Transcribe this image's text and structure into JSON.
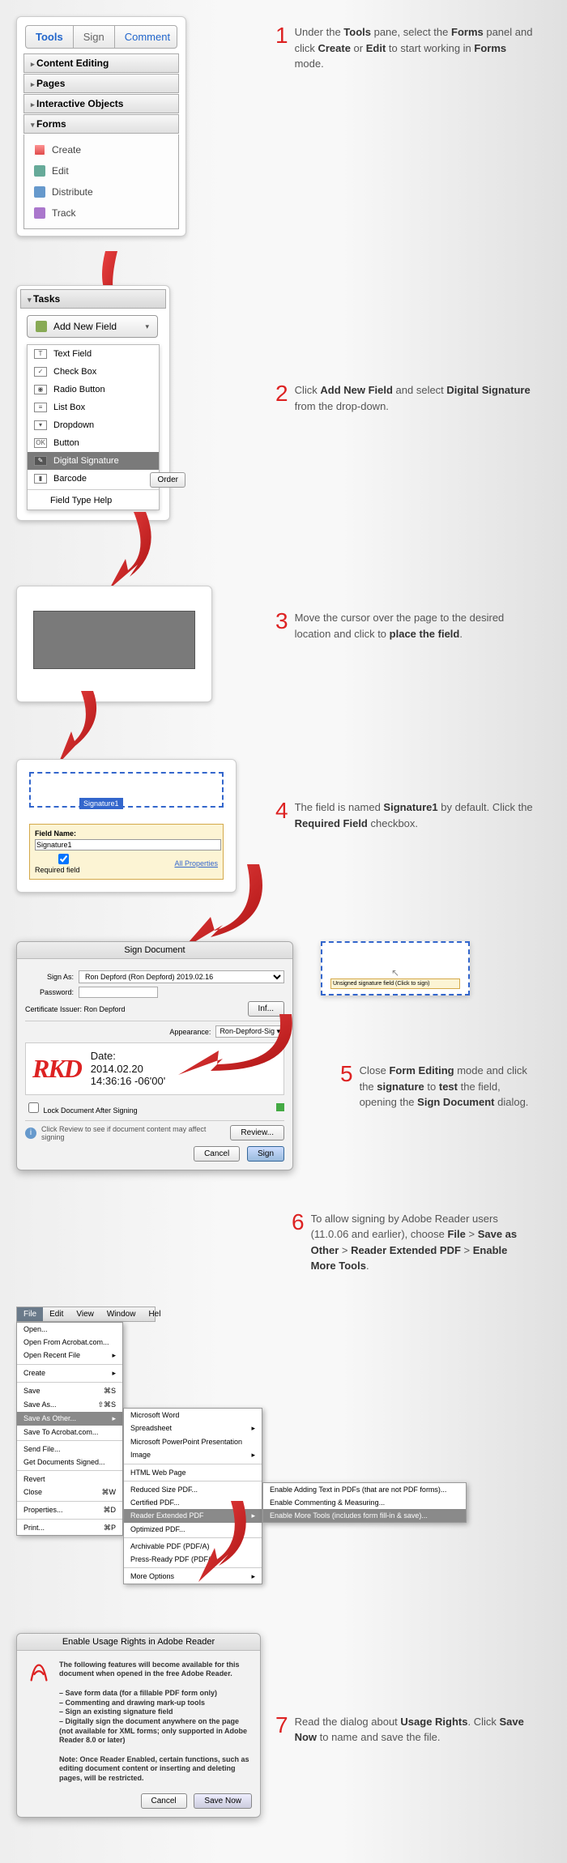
{
  "tabs": {
    "tools": "Tools",
    "sign": "Sign",
    "comment": "Comment"
  },
  "accordion": {
    "content_editing": "Content Editing",
    "pages": "Pages",
    "interactive": "Interactive Objects",
    "forms": "Forms"
  },
  "forms_items": {
    "create": "Create",
    "edit": "Edit",
    "distribute": "Distribute",
    "track": "Track"
  },
  "step1": {
    "num": "1",
    "text": "Under the <b>Tools</b> pane, select the <b>Forms</b> panel and click <b>Create</b> or <b>Edit</b> to start working in <b>Forms</b> mode."
  },
  "tasks": {
    "header": "Tasks",
    "add_new_field": "Add New Field"
  },
  "field_types": {
    "text": "Text Field",
    "check": "Check Box",
    "radio": "Radio Button",
    "list": "List Box",
    "dropdown": "Dropdown",
    "button": "Button",
    "digsig": "Digital Signature",
    "barcode": "Barcode",
    "help": "Field Type Help"
  },
  "order_btn": "Order",
  "step2": {
    "num": "2",
    "text": "Click <b>Add New Field</b> and select <b>Digital Signature</b> from the drop-down."
  },
  "step3": {
    "num": "3",
    "text": "Move the cursor over the page to the desired location and click to <b>place the field</b>."
  },
  "sig": {
    "label": "Signature1",
    "fname_label": "Field Name:",
    "fname_val": "Signature1",
    "req": "Required field",
    "allprops": "All Properties"
  },
  "step4": {
    "num": "4",
    "text": " The field is named <b>Signature1</b> by default. Click the <b>Required Field</b> checkbox."
  },
  "signdlg": {
    "title": "Sign Document",
    "sign_as": "Sign As:",
    "sign_as_val": "Ron Depford (Ron Depford) 2019.02.16",
    "password": "Password:",
    "issuer": "Certificate Issuer: Ron Depford",
    "info": "Inf...",
    "appearance": "Appearance:",
    "appearance_val": "Ron-Depford-Sig ▾",
    "rkd": "RKD",
    "date_label": "Date:",
    "date1": "2014.02.20",
    "date2": "14:36:16 -06'00'",
    "lock": "Lock Document After Signing",
    "review_msg": "Click Review to see if document content may affect signing",
    "review": "Review...",
    "cancel": "Cancel",
    "sign": "Sign"
  },
  "unsigned": {
    "tag": "Unsigned signature field (Click to sign)"
  },
  "step5": {
    "num": "5",
    "text": "Close <b>Form Editing</b> mode and click the <b>signature</b> to <b>test</b> the field, opening the <b>Sign Document</b> dialog."
  },
  "menubar": {
    "file": "File",
    "edit": "Edit",
    "view": "View",
    "window": "Window",
    "help": "Hel"
  },
  "menu1": {
    "open": "Open...",
    "open_acrobat": "Open From Acrobat.com...",
    "open_recent": "Open Recent File",
    "create": "Create",
    "save": "Save",
    "save_as": "Save As...",
    "save_other": "Save As Other...",
    "save_acrobat": "Save To Acrobat.com...",
    "send": "Send File...",
    "get_signed": "Get Documents Signed...",
    "revert": "Revert",
    "close": "Close",
    "properties": "Properties...",
    "print": "Print...",
    "short_save": "⌘S",
    "short_saveas": "⇧⌘S",
    "short_close": "⌘W",
    "short_props": "⌘D",
    "short_print": "⌘P"
  },
  "menu2": {
    "word": "Microsoft Word",
    "sheet": "Spreadsheet",
    "ppt": "Microsoft PowerPoint Presentation",
    "image": "Image",
    "html": "HTML Web Page",
    "reduced": "Reduced Size PDF...",
    "certified": "Certified PDF...",
    "reader_ext": "Reader Extended PDF",
    "optimized": "Optimized PDF...",
    "archival": "Archivable PDF (PDF/A)",
    "press": "Press-Ready PDF (PDF/X)",
    "more": "More Options"
  },
  "menu3": {
    "adding_text": "Enable Adding Text in PDFs (that are not PDF forms)...",
    "commenting": "Enable Commenting & Measuring...",
    "more_tools": "Enable More Tools (includes form fill-in & save)..."
  },
  "step6": {
    "num": "6",
    "text": "To allow signing by Adobe Reader users (11.0.06 and earlier), choose <b>File</b> > <b>Save as Other</b> > <b>Reader Extended PDF</b> > <b>Enable More Tools</b>."
  },
  "usage": {
    "title": "Enable Usage Rights in Adobe Reader",
    "intro": "The following features will become available for this document when opened in the free Adobe Reader.",
    "b1": "– Save form data (for a fillable PDF form only)",
    "b2": "– Commenting and drawing mark-up tools",
    "b3": "– Sign an existing signature field",
    "b4": "– Digitally sign the document anywhere on the page (not available for XML forms; only supported in Adobe Reader 8.0 or later)",
    "note": "Note: Once Reader Enabled, certain functions, such as editing document content or inserting and deleting pages, will be restricted.",
    "cancel": "Cancel",
    "save_now": "Save Now"
  },
  "step7": {
    "num": "7",
    "text": "Read the dialog about <b>Usage Rights</b>. Click <b>Save Now</b> to name and save the file."
  }
}
